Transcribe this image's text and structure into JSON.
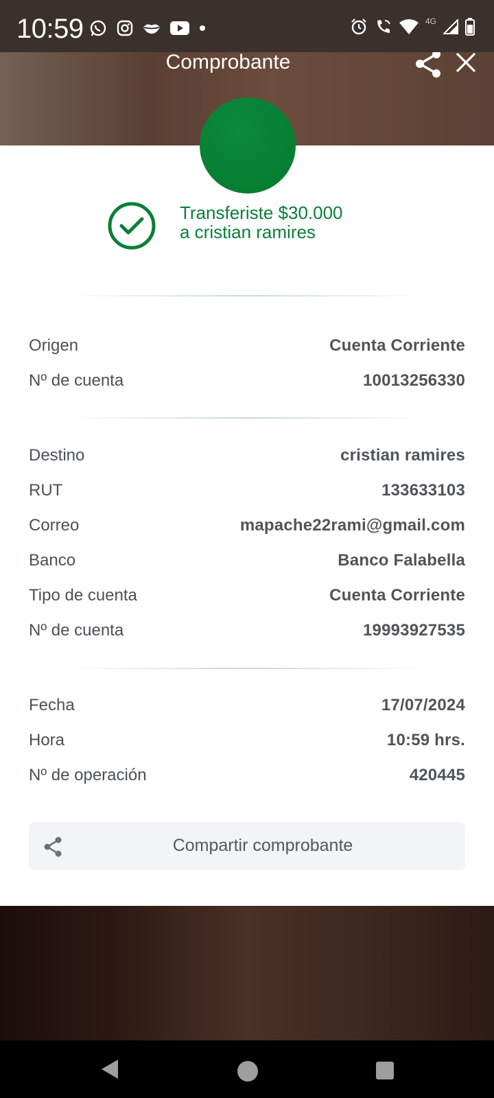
{
  "status_bar": {
    "time": "10:59",
    "network": "4G",
    "icons_left": [
      "whatsapp-icon",
      "instagram-icon",
      "lips-icon",
      "youtube-icon",
      "dot-icon"
    ],
    "icons_right": [
      "alarm-icon",
      "wifi-call-icon",
      "wifi-icon",
      "signal-icon",
      "battery-icon"
    ]
  },
  "header": {
    "title": "Comprobante"
  },
  "success": {
    "line1": "Transferiste $30.000",
    "line2": "a cristian ramires",
    "color": "#0a7f37"
  },
  "origin": {
    "rows": [
      {
        "label": "Origen",
        "value": "Cuenta Corriente"
      },
      {
        "label": "Nº de cuenta",
        "value": "10013256330"
      }
    ]
  },
  "destination": {
    "rows": [
      {
        "label": "Destino",
        "value": "cristian ramires"
      },
      {
        "label": "RUT",
        "value": "133633103"
      },
      {
        "label": "Correo",
        "value": "mapache22rami@gmail.com"
      },
      {
        "label": "Banco",
        "value": "Banco Falabella"
      },
      {
        "label": "Tipo de cuenta",
        "value": "Cuenta Corriente"
      },
      {
        "label": "Nº de cuenta",
        "value": "19993927535"
      }
    ]
  },
  "operation": {
    "rows": [
      {
        "label": "Fecha",
        "value": "17/07/2024"
      },
      {
        "label": "Hora",
        "value": "10:59 hrs."
      },
      {
        "label": "Nº de operación",
        "value": "420445"
      }
    ]
  },
  "share_button": {
    "label": "Compartir comprobante"
  }
}
